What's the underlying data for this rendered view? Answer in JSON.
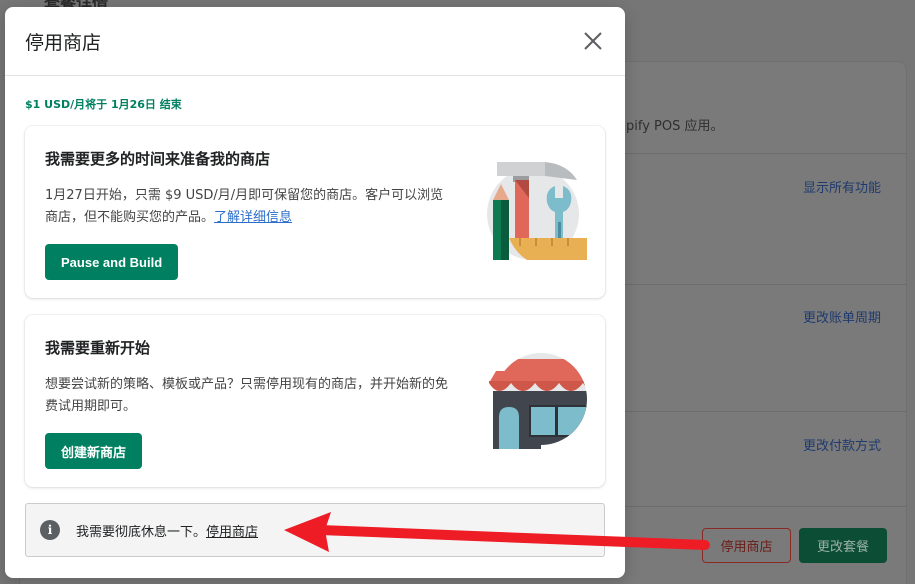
{
  "background": {
    "section_title": "套餐详情",
    "pos_text": "pify POS 应用。",
    "links": [
      {
        "label": "显示所有功能"
      },
      {
        "label": "更改账单周期"
      },
      {
        "label": "更改付款方式"
      }
    ],
    "deactivate_button": "停用商店",
    "change_plan_button": "更改套餐"
  },
  "modal": {
    "title": "停用商店",
    "close_icon": "close-icon",
    "price_note": "$1 USD/月将于 1月26日 结束",
    "options": [
      {
        "title": "我需要更多的时间来准备我的商店",
        "description": "1月27日开始，只需 $9 USD/月/月即可保留您的商店。客户可以浏览商店，但不能购买您的产品。",
        "link": "了解详细信息",
        "button": "Pause and Build",
        "illustration": "tools-icon"
      },
      {
        "title": "我需要重新开始",
        "description": "想要尝试新的策略、模板或产品？只需停用现有的商店，并开始新的免费试用期即可。",
        "button": "创建新商店",
        "illustration": "storefront-icon"
      }
    ],
    "banner": {
      "icon": "info-icon",
      "text": "我需要彻底休息一下。",
      "link": "停用商店"
    }
  },
  "annotation": {
    "type": "arrow",
    "color": "#ee1c25"
  },
  "colors": {
    "primary_green": "#008060",
    "link_blue": "#2c6ecb",
    "overlay_gray": "#767676"
  }
}
